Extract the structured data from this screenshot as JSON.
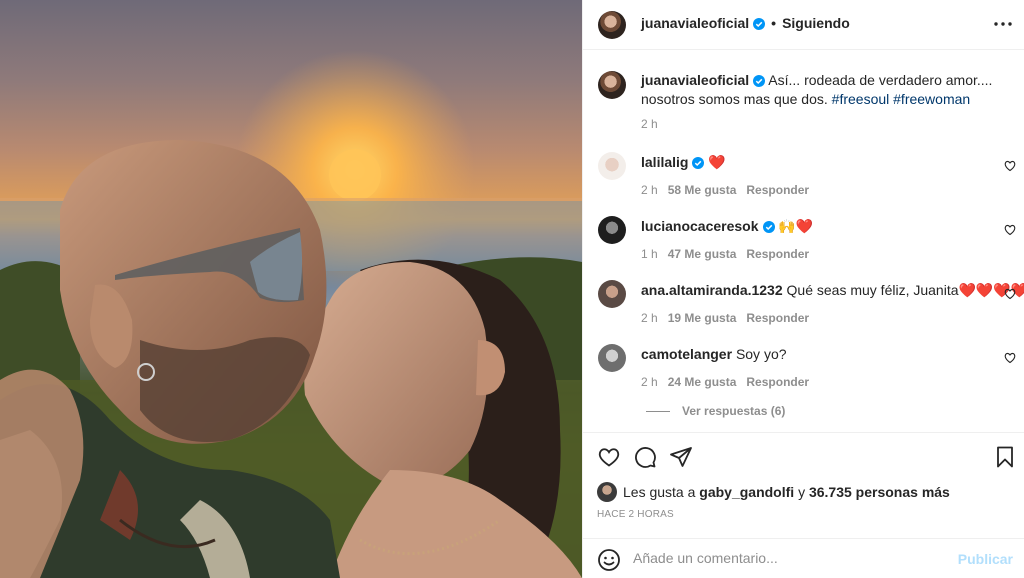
{
  "post": {
    "username": "juanavialeoficial",
    "dot": "•",
    "follow_status": "Siguiendo",
    "more_icon": "more-horizontal-icon"
  },
  "caption": {
    "username": "juanavialeoficial",
    "text": "Así... rodeada de verdadero amor.... nosotros somos mas que dos.",
    "hashtags": [
      "#freesoul",
      "#freewoman"
    ],
    "time": "2 h"
  },
  "comments": [
    {
      "username": "lalilalig",
      "verified": true,
      "text": "❤️",
      "time": "2 h",
      "likes": "58 Me gusta",
      "reply": "Responder"
    },
    {
      "username": "lucianocaceresok",
      "verified": true,
      "text": "🙌❤️",
      "time": "1 h",
      "likes": "47 Me gusta",
      "reply": "Responder"
    },
    {
      "username": "ana.altamiranda.1232",
      "verified": false,
      "text": "Qué seas muy féliz, Juanita❤️❤️❤️❤️",
      "time": "2 h",
      "likes": "19 Me gusta",
      "reply": "Responder"
    },
    {
      "username": "camotelanger",
      "verified": false,
      "text": "Soy yo?",
      "time": "2 h",
      "likes": "24 Me gusta",
      "reply": "Responder"
    }
  ],
  "view_replies": "Ver respuestas (6)",
  "likes": {
    "prefix": "Les gusta a",
    "user": "gaby_gandolfi",
    "joiner": "y",
    "count": "36.735 personas más"
  },
  "posted_ago": "HACE 2 HORAS",
  "add_comment": {
    "placeholder": "Añade un comentario...",
    "publish": "Publicar"
  },
  "colors": {
    "verified": "#0095f6",
    "hashtag": "#00376b",
    "muted": "#8e8e8e",
    "publish_disabled": "#b2dffc",
    "heart": "#ed4956"
  }
}
